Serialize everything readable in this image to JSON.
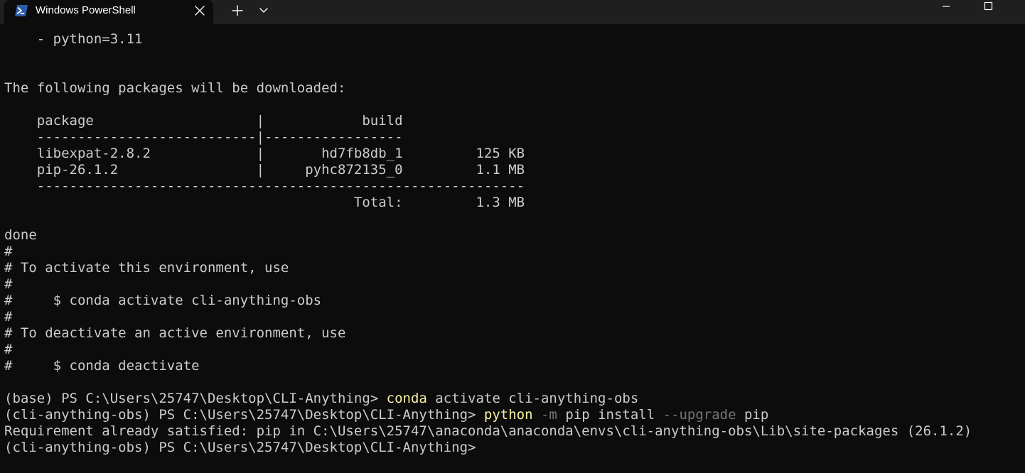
{
  "app": {
    "tab_title": "Windows PowerShell",
    "icons": {
      "tab": "powershell-icon",
      "close": "close-icon",
      "new_tab": "plus-icon",
      "dropdown": "chevron-down-icon",
      "minimize": "minimize-icon",
      "maximize": "maximize-icon"
    }
  },
  "colors": {
    "background": "#0c0c0c",
    "tabbar": "#1f1f1f",
    "text": "#cccccc",
    "command": "#f9f1a5",
    "parameter": "#767676",
    "powershell_icon": "#2b5dab"
  },
  "terminal": {
    "lines": [
      "    - python=3.11",
      "",
      "",
      "The following packages will be downloaded:",
      "",
      "    package                    |            build",
      "    ---------------------------|-----------------",
      "    libexpat-2.8.2             |       hd7fb8db_1         125 KB",
      "    pip-26.1.2                 |     pyhc872135_0         1.1 MB",
      "    ------------------------------------------------------------",
      "                                           Total:         1.3 MB",
      "",
      "done",
      "#",
      "# To activate this environment, use",
      "#",
      "#     $ conda activate cli-anything-obs",
      "#",
      "# To deactivate an active environment, use",
      "#",
      "#     $ conda deactivate",
      "",
      "",
      "",
      "Requirement already satisfied: pip in C:\\Users\\25747\\anaconda\\anaconda\\envs\\cli-anything-obs\\Lib\\site-packages (26.1.2)",
      "(cli-anything-obs) PS C:\\Users\\25747\\Desktop\\CLI-Anything>"
    ],
    "prompt_1": {
      "prompt": "(base) PS C:\\Users\\25747\\Desktop\\CLI-Anything> ",
      "command": "conda",
      "args": " activate cli-anything-obs"
    },
    "prompt_2": {
      "prompt": "(cli-anything-obs) PS C:\\Users\\25747\\Desktop\\CLI-Anything> ",
      "command": "python",
      "flag1": " -m",
      "args1": " pip install",
      "flag2": " --upgrade",
      "args2": " pip"
    }
  }
}
